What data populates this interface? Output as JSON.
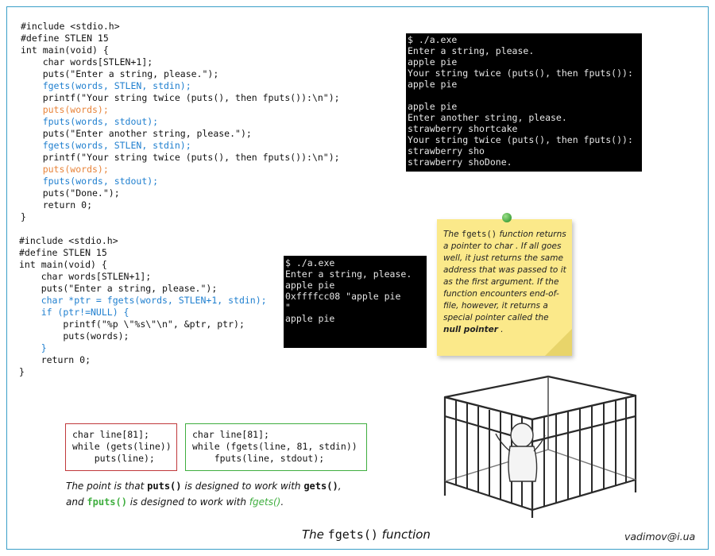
{
  "program1": {
    "lines": [
      {
        "text": "#include <stdio.h>",
        "color": "black"
      },
      {
        "text": "#define STLEN 15",
        "color": "black"
      },
      {
        "text": "int main(void) {",
        "color": "black"
      },
      {
        "text": "    char words[STLEN+1];",
        "color": "black"
      },
      {
        "text": "    puts(\"Enter a string, please.\");",
        "color": "black"
      },
      {
        "text": "    fgets(words, STLEN, stdin);",
        "color": "blue"
      },
      {
        "text": "    printf(\"Your string twice (puts(), then fputs()):\\n\");",
        "color": "black"
      },
      {
        "text": "    puts(words);",
        "color": "orange"
      },
      {
        "text": "    fputs(words, stdout);",
        "color": "blue"
      },
      {
        "text": "    puts(\"Enter another string, please.\");",
        "color": "black"
      },
      {
        "text": "    fgets(words, STLEN, stdin);",
        "color": "blue"
      },
      {
        "text": "    printf(\"Your string twice (puts(), then fputs()):\\n\");",
        "color": "black"
      },
      {
        "text": "    puts(words);",
        "color": "orange"
      },
      {
        "text": "    fputs(words, stdout);",
        "color": "blue"
      },
      {
        "text": "    puts(\"Done.\");",
        "color": "black"
      },
      {
        "text": "    return 0;",
        "color": "black"
      },
      {
        "text": "}",
        "color": "black"
      }
    ]
  },
  "terminal1": {
    "lines": [
      "$ ./a.exe",
      "Enter a string, please.",
      "apple pie",
      "Your string twice (puts(), then fputs()):",
      "apple pie",
      "",
      "apple pie",
      "Enter another string, please.",
      "strawberry shortcake",
      "Your string twice (puts(), then fputs()):",
      "strawberry sho",
      "strawberry shoDone."
    ]
  },
  "program2": {
    "lines": [
      {
        "text": "#include <stdio.h>",
        "color": "black"
      },
      {
        "text": "#define STLEN 15",
        "color": "black"
      },
      {
        "text": "int main(void) {",
        "color": "black"
      },
      {
        "text": "    char words[STLEN+1];",
        "color": "black"
      },
      {
        "text": "    puts(\"Enter a string, please.\");",
        "color": "black"
      },
      {
        "text": "    char *ptr = fgets(words, STLEN+1, stdin);",
        "color": "blue"
      },
      {
        "text": "    if (ptr!=NULL) {",
        "color": "blue"
      },
      {
        "text": "        printf(\"%p \\\"%s\\\"\\n\", &ptr, ptr);",
        "color": "black"
      },
      {
        "text": "        puts(words);",
        "color": "black"
      },
      {
        "text": "    }",
        "color": "blue"
      },
      {
        "text": "    return 0;",
        "color": "black"
      },
      {
        "text": "}",
        "color": "black"
      }
    ]
  },
  "terminal2": {
    "lines": [
      "$ ./a.exe",
      "Enter a string, please.",
      "apple pie",
      "0xffffcc08 \"apple pie",
      "\"",
      "apple pie"
    ]
  },
  "note": {
    "p1": "The ",
    "code": "fgets()",
    "p2": " function returns a pointer to char . If all goes well, it just returns the same address that was passed to it as the first argument. If the function encounters end-of-file, however, it returns a special pointer called the ",
    "bold": "null pointer",
    "p3": " ."
  },
  "box_gets": {
    "lines": [
      "char line[81];",
      "while (gets(line))",
      "    puts(line);"
    ],
    "border_color": "#c0393b"
  },
  "box_fgets": {
    "lines": [
      "char line[81];",
      "while (fgets(line, 81, stdin))",
      "    fputs(line, stdout);"
    ],
    "border_color": "#3fae3f"
  },
  "point": {
    "t1": "The point is that ",
    "puts": "puts()",
    "t2": " is designed to work with ",
    "gets": "gets()",
    "t3": ",",
    "t4": "and ",
    "fputs": "fputs()",
    "t5": " is designed to work with ",
    "fgets": "fgets()",
    "t6": "."
  },
  "caption": {
    "pre": "The ",
    "code": "fgets()",
    "post": " function"
  },
  "email": "vadimov@i.ua",
  "colors": {
    "blue": "#1f7fcf",
    "orange": "#e8843a",
    "green": "#3fae3f",
    "red": "#c0393b",
    "frame": "#3a9ec7"
  }
}
